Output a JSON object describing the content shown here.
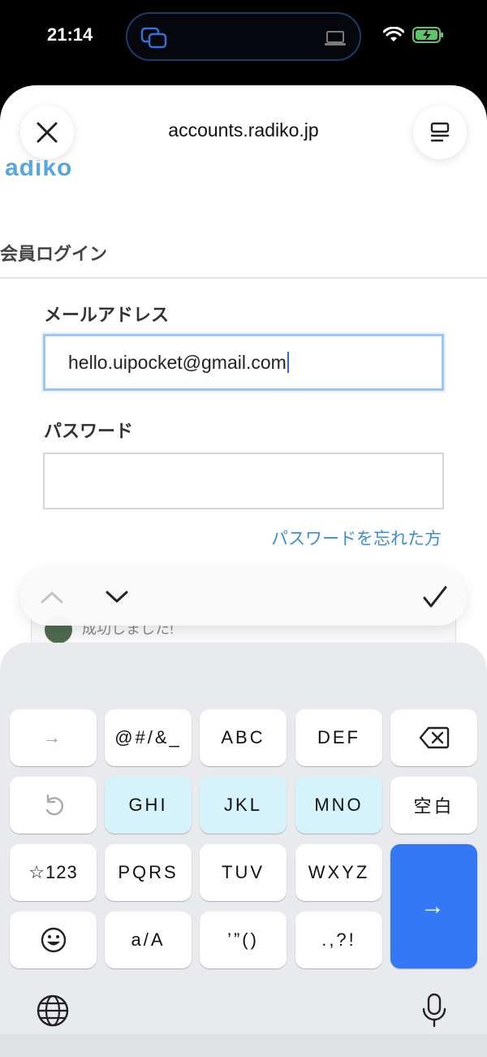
{
  "status": {
    "time": "21:14"
  },
  "browser": {
    "url": "accounts.radiko.jp"
  },
  "page": {
    "logo": "adiko",
    "section_title": "会員ログイン",
    "email_label": "メールアドレス",
    "email_value": "hello.uipocket@gmail.com",
    "password_label": "パスワード",
    "password_value": "",
    "forgot_link": "パスワードを忘れた方",
    "toast_text": "成功しました!"
  },
  "keyboard": {
    "row1": [
      "→",
      "@#/&_",
      "ABC",
      "DEF",
      "⌫"
    ],
    "row2": [
      "↺",
      "GHI",
      "JKL",
      "MNO",
      "空白"
    ],
    "row3": [
      "☆123",
      "PQRS",
      "TUV",
      "WXYZ"
    ],
    "row4": [
      "☺",
      "a/A",
      "’”()",
      ".,?!"
    ],
    "return_label": "→"
  },
  "colors": {
    "accent": "#3478f6",
    "link": "#3b8fd0",
    "focus_border": "#9cc5ef",
    "glow_key": "#d6f3fb"
  },
  "icons": [
    "close-icon",
    "menu-icon",
    "chevron-up-icon",
    "chevron-down-icon",
    "checkmark-icon",
    "globe-icon",
    "microphone-icon",
    "wifi-icon",
    "battery-icon"
  ]
}
